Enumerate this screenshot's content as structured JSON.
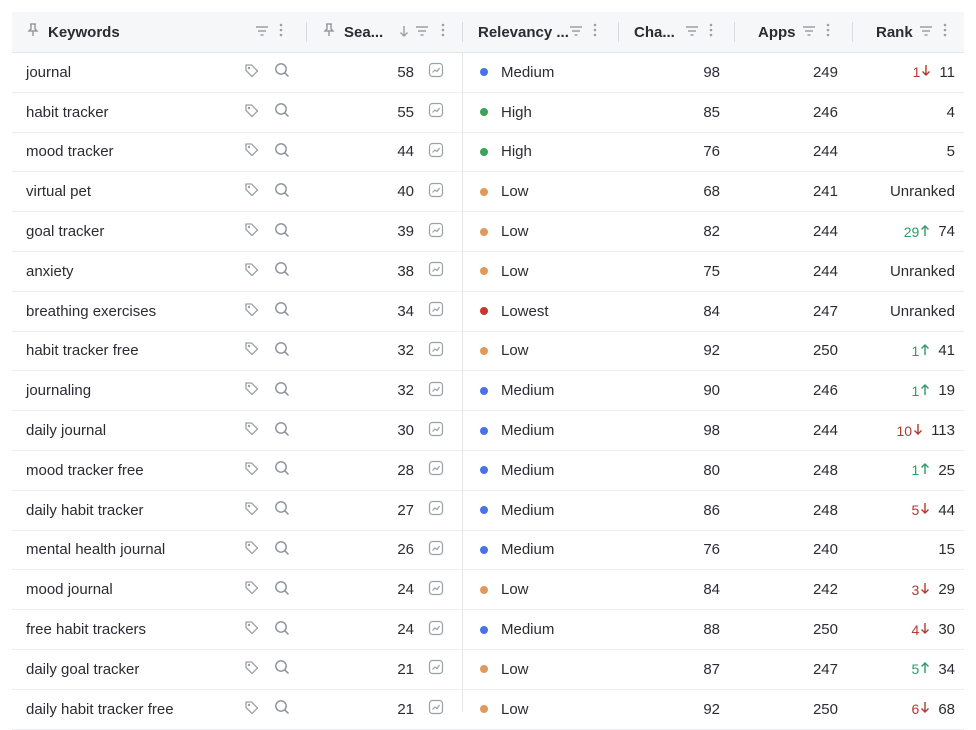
{
  "colors": {
    "Medium": "#4a72e8",
    "High": "#3aa35a",
    "Low": "#e0995a",
    "Lowest": "#c9362c",
    "rank_up": "#2e9a6a",
    "rank_down": "#b03a2e"
  },
  "columns": {
    "keywords": "Keywords",
    "search": "Sea...",
    "relevancy": "Relevancy ...",
    "chance": "Cha...",
    "apps": "Apps",
    "rank": "Rank"
  },
  "rows": [
    {
      "keyword": "journal",
      "search": "58",
      "relevancy": "Medium",
      "chance": "98",
      "apps": "249",
      "rank_change": "1",
      "rank_dir": "down",
      "rank": "11"
    },
    {
      "keyword": "habit tracker",
      "search": "55",
      "relevancy": "High",
      "chance": "85",
      "apps": "246",
      "rank_change": "",
      "rank_dir": "",
      "rank": "4"
    },
    {
      "keyword": "mood tracker",
      "search": "44",
      "relevancy": "High",
      "chance": "76",
      "apps": "244",
      "rank_change": "",
      "rank_dir": "",
      "rank": "5"
    },
    {
      "keyword": "virtual pet",
      "search": "40",
      "relevancy": "Low",
      "chance": "68",
      "apps": "241",
      "rank_change": "",
      "rank_dir": "",
      "rank": "Unranked"
    },
    {
      "keyword": "goal tracker",
      "search": "39",
      "relevancy": "Low",
      "chance": "82",
      "apps": "244",
      "rank_change": "29",
      "rank_dir": "up",
      "rank": "74"
    },
    {
      "keyword": "anxiety",
      "search": "38",
      "relevancy": "Low",
      "chance": "75",
      "apps": "244",
      "rank_change": "",
      "rank_dir": "",
      "rank": "Unranked"
    },
    {
      "keyword": "breathing exercises",
      "search": "34",
      "relevancy": "Lowest",
      "chance": "84",
      "apps": "247",
      "rank_change": "",
      "rank_dir": "",
      "rank": "Unranked"
    },
    {
      "keyword": "habit tracker free",
      "search": "32",
      "relevancy": "Low",
      "chance": "92",
      "apps": "250",
      "rank_change": "1",
      "rank_dir": "up",
      "rank": "41"
    },
    {
      "keyword": "journaling",
      "search": "32",
      "relevancy": "Medium",
      "chance": "90",
      "apps": "246",
      "rank_change": "1",
      "rank_dir": "up",
      "rank": "19"
    },
    {
      "keyword": "daily journal",
      "search": "30",
      "relevancy": "Medium",
      "chance": "98",
      "apps": "244",
      "rank_change": "10",
      "rank_dir": "down",
      "rank": "113"
    },
    {
      "keyword": "mood tracker free",
      "search": "28",
      "relevancy": "Medium",
      "chance": "80",
      "apps": "248",
      "rank_change": "1",
      "rank_dir": "up",
      "rank": "25"
    },
    {
      "keyword": "daily habit tracker",
      "search": "27",
      "relevancy": "Medium",
      "chance": "86",
      "apps": "248",
      "rank_change": "5",
      "rank_dir": "down",
      "rank": "44"
    },
    {
      "keyword": "mental health journal",
      "search": "26",
      "relevancy": "Medium",
      "chance": "76",
      "apps": "240",
      "rank_change": "",
      "rank_dir": "",
      "rank": "15"
    },
    {
      "keyword": "mood journal",
      "search": "24",
      "relevancy": "Low",
      "chance": "84",
      "apps": "242",
      "rank_change": "3",
      "rank_dir": "down",
      "rank": "29"
    },
    {
      "keyword": "free habit trackers",
      "search": "24",
      "relevancy": "Medium",
      "chance": "88",
      "apps": "250",
      "rank_change": "4",
      "rank_dir": "down",
      "rank": "30"
    },
    {
      "keyword": "daily goal tracker",
      "search": "21",
      "relevancy": "Low",
      "chance": "87",
      "apps": "247",
      "rank_change": "5",
      "rank_dir": "up",
      "rank": "34"
    },
    {
      "keyword": "daily habit tracker free",
      "search": "21",
      "relevancy": "Low",
      "chance": "92",
      "apps": "250",
      "rank_change": "6",
      "rank_dir": "down",
      "rank": "68"
    }
  ]
}
